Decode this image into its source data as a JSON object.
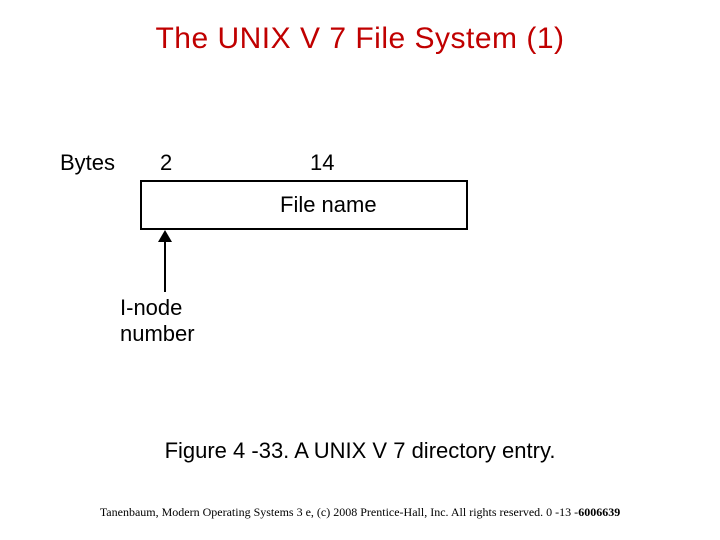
{
  "title": "The UNIX V 7 File System (1)",
  "diagram": {
    "bytes_label": "Bytes",
    "col1_width": "2",
    "col2_width": "14",
    "col2_label": "File name",
    "arrow_label_line1": "I-node",
    "arrow_label_line2": "number"
  },
  "caption": "Figure 4 -33. A UNIX V 7 directory entry.",
  "footer": {
    "text_normal": "Tanenbaum, Modern Operating Systems 3 e, (c) 2008 Prentice-Hall, Inc. All rights reserved. 0 -13 -",
    "text_bold": "6006639"
  }
}
